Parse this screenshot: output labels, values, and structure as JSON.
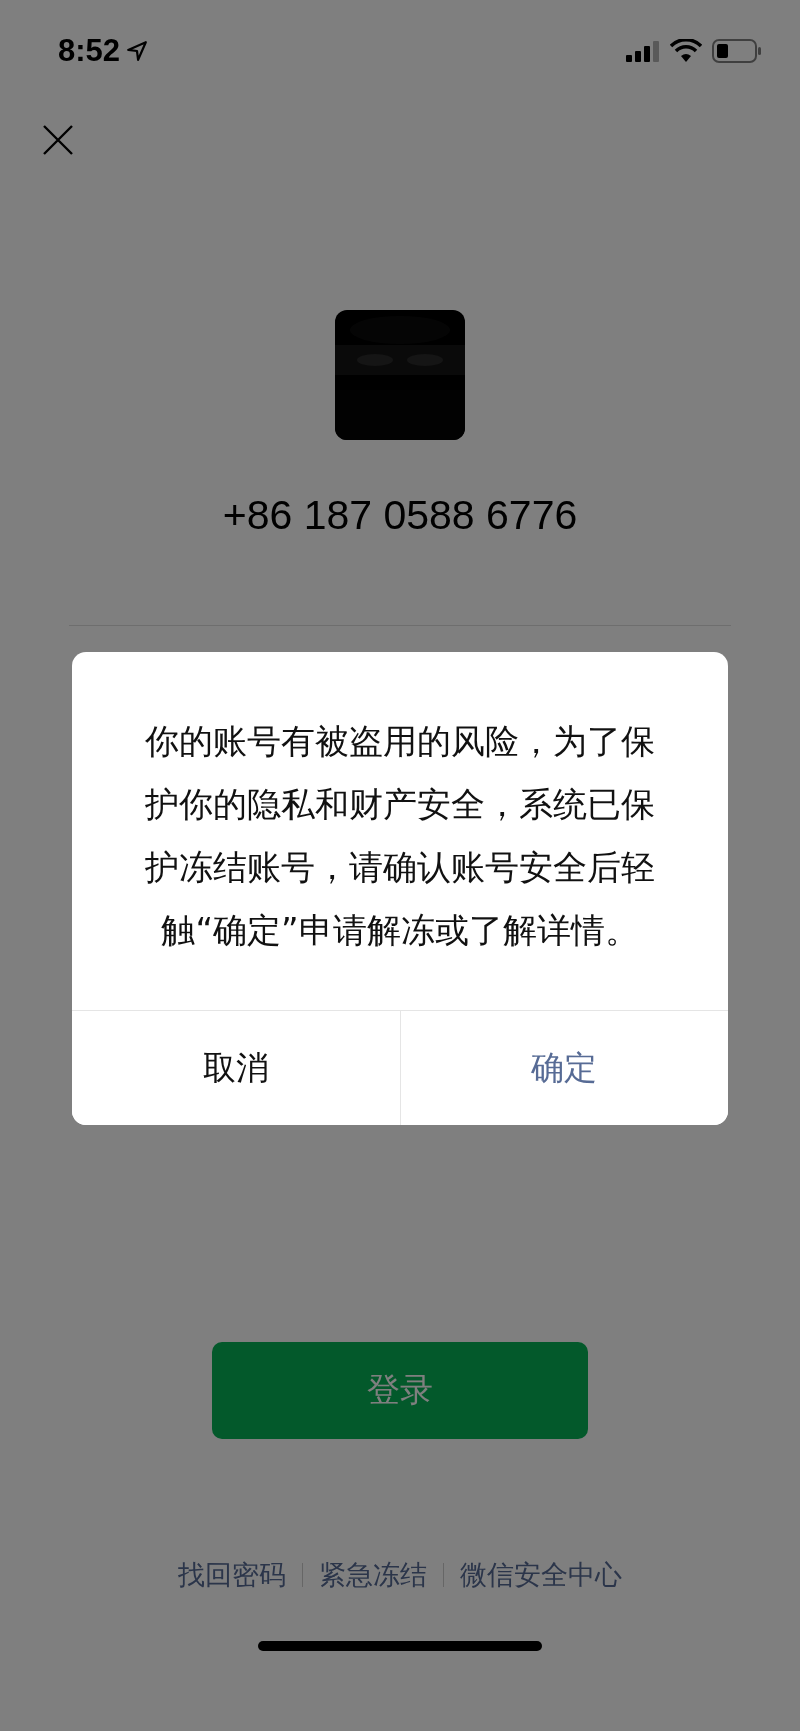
{
  "status_bar": {
    "time": "8:52"
  },
  "phone_number": "+86 187 0588 6776",
  "login_button": {
    "label": "登录"
  },
  "links": [
    "找回密码",
    "紧急冻结",
    "微信安全中心"
  ],
  "dialog": {
    "message": "你的账号有被盗用的风险，为了保护你的隐私和财产安全，系统已保护冻结账号，请确认账号安全后轻触“确定”申请解冻或了解详情。",
    "buttons": [
      {
        "label": "取消",
        "kind": "cancel"
      },
      {
        "label": "确定",
        "kind": "primary"
      }
    ]
  }
}
